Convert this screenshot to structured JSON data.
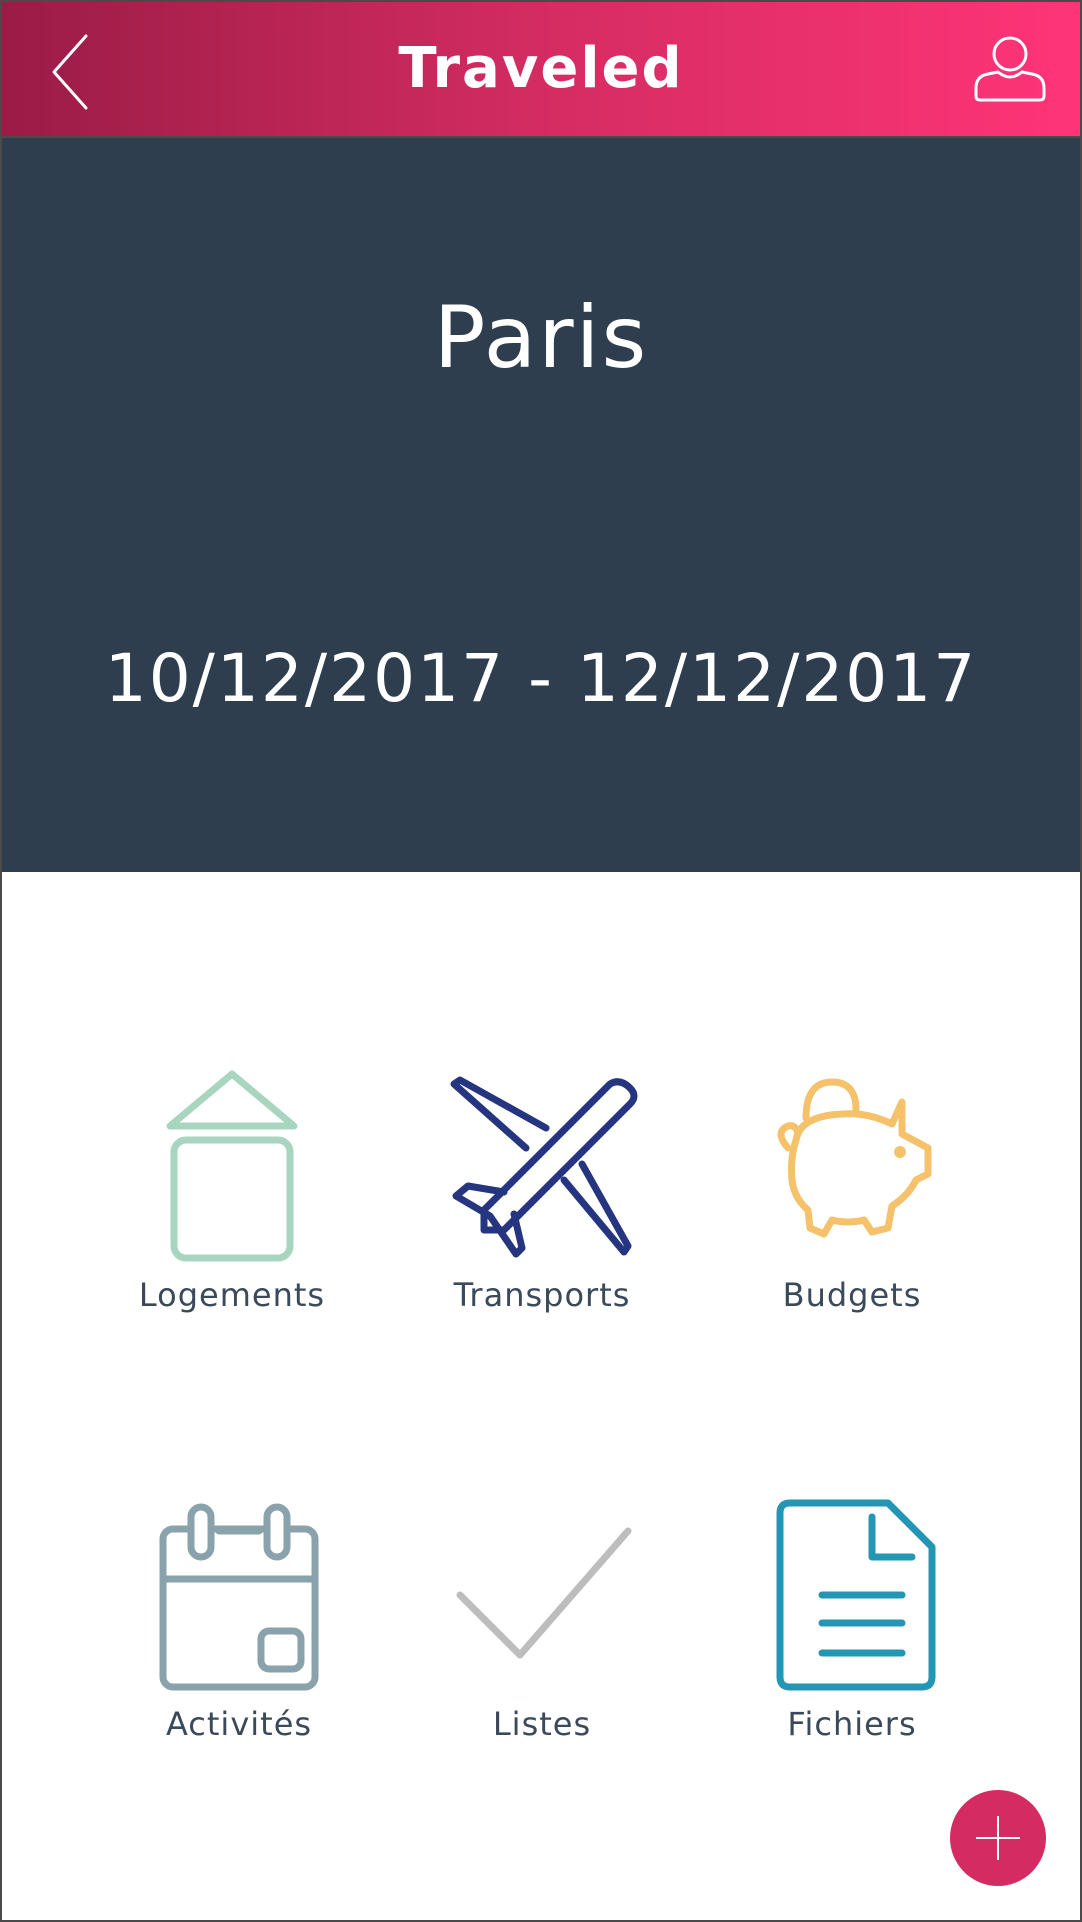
{
  "header": {
    "title": "Traveled",
    "back_icon": "chevron-left-icon",
    "profile_icon": "user-icon",
    "gradient_start": "#9a1c46",
    "gradient_end": "#ff3478"
  },
  "trip": {
    "city": "Paris",
    "dates": "10/12/2017 - 12/12/2017"
  },
  "categories": [
    {
      "label": "Logements",
      "icon": "house-icon",
      "color": "#a8d5c0"
    },
    {
      "label": "Transports",
      "icon": "airplane-icon",
      "color": "#26357f"
    },
    {
      "label": "Budgets",
      "icon": "piggy-bank-icon",
      "color": "#f5c26b"
    },
    {
      "label": "Activités",
      "icon": "calendar-icon",
      "color": "#8aa2ab"
    },
    {
      "label": "Listes",
      "icon": "checkmark-icon",
      "color": "#bdbdbd"
    },
    {
      "label": "Fichiers",
      "icon": "document-icon",
      "color": "#2396b3"
    }
  ],
  "fab": {
    "icon": "plus-icon",
    "color": "#d42c62"
  }
}
